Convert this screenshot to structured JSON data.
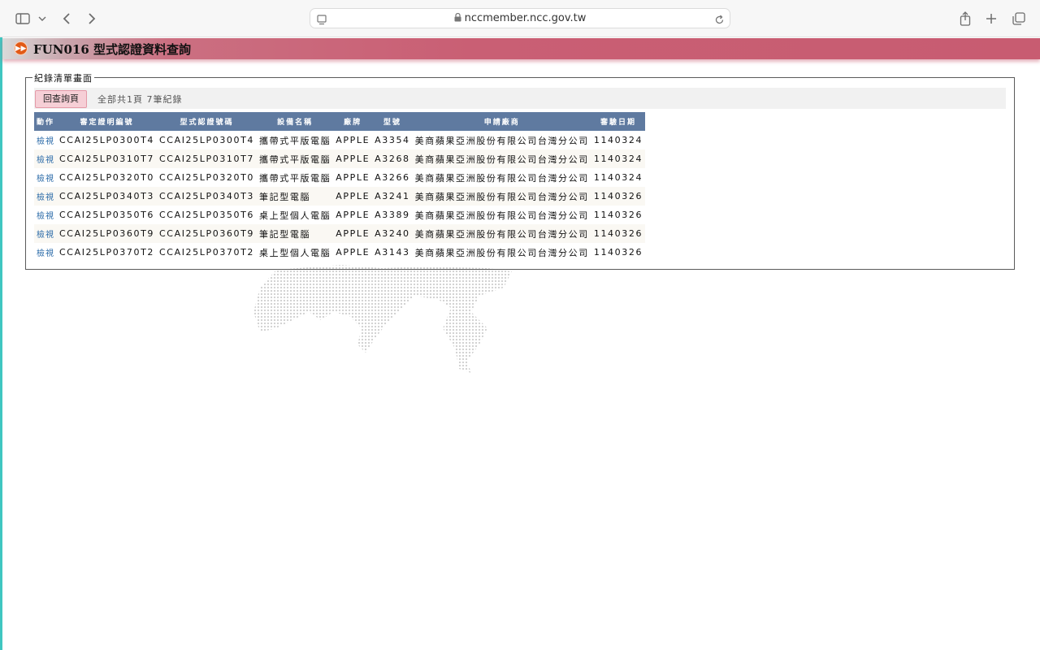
{
  "browser": {
    "url": "nccmember.ncc.gov.tw"
  },
  "header": {
    "title": "FUN016 型式認證資料查詢"
  },
  "records": {
    "legend": "紀錄清單畫面",
    "back_button": "回查詢頁",
    "summary": "全部共1頁 7筆紀錄",
    "columns": [
      "動作",
      "審定證明編號",
      "型式認證號碼",
      "設備名稱",
      "廠牌",
      "型號",
      "申請廠商",
      "審驗日期"
    ],
    "rows": [
      {
        "action": "檢視",
        "cert_no": "CCAI25LP0300T4",
        "type_no": "CCAI25LP0300T4",
        "device": "攜帶式平版電腦",
        "brand": "APPLE",
        "model": "A3354",
        "applicant": "美商蘋果亞洲股份有限公司台灣分公司",
        "date": "1140324"
      },
      {
        "action": "檢視",
        "cert_no": "CCAI25LP0310T7",
        "type_no": "CCAI25LP0310T7",
        "device": "攜帶式平版電腦",
        "brand": "APPLE",
        "model": "A3268",
        "applicant": "美商蘋果亞洲股份有限公司台灣分公司",
        "date": "1140324"
      },
      {
        "action": "檢視",
        "cert_no": "CCAI25LP0320T0",
        "type_no": "CCAI25LP0320T0",
        "device": "攜帶式平版電腦",
        "brand": "APPLE",
        "model": "A3266",
        "applicant": "美商蘋果亞洲股份有限公司台灣分公司",
        "date": "1140324"
      },
      {
        "action": "檢視",
        "cert_no": "CCAI25LP0340T3",
        "type_no": "CCAI25LP0340T3",
        "device": "筆記型電腦",
        "brand": "APPLE",
        "model": "A3241",
        "applicant": "美商蘋果亞洲股份有限公司台灣分公司",
        "date": "1140326"
      },
      {
        "action": "檢視",
        "cert_no": "CCAI25LP0350T6",
        "type_no": "CCAI25LP0350T6",
        "device": "桌上型個人電腦",
        "brand": "APPLE",
        "model": "A3389",
        "applicant": "美商蘋果亞洲股份有限公司台灣分公司",
        "date": "1140326"
      },
      {
        "action": "檢視",
        "cert_no": "CCAI25LP0360T9",
        "type_no": "CCAI25LP0360T9",
        "device": "筆記型電腦",
        "brand": "APPLE",
        "model": "A3240",
        "applicant": "美商蘋果亞洲股份有限公司台灣分公司",
        "date": "1140326"
      },
      {
        "action": "檢視",
        "cert_no": "CCAI25LP0370T2",
        "type_no": "CCAI25LP0370T2",
        "device": "桌上型個人電腦",
        "brand": "APPLE",
        "model": "A3143",
        "applicant": "美商蘋果亞洲股份有限公司台灣分公司",
        "date": "1140326"
      }
    ]
  },
  "icons": {
    "sidebar": "sidebar-icon",
    "chevron": "chevron-down-icon",
    "back": "back-icon",
    "forward": "forward-icon",
    "page_menu": "page-menu-icon",
    "lock": "lock-icon",
    "reload": "reload-icon",
    "share": "share-icon",
    "new_tab": "plus-icon",
    "tabs": "tabs-overview-icon",
    "title": "fast-forward-icon"
  },
  "colors": {
    "title_bar": "#c85c71",
    "table_header": "#5f7aa0",
    "back_button": "#f6cfd6",
    "link": "#2a6aa8",
    "left_edge": "#3fc6c1"
  }
}
